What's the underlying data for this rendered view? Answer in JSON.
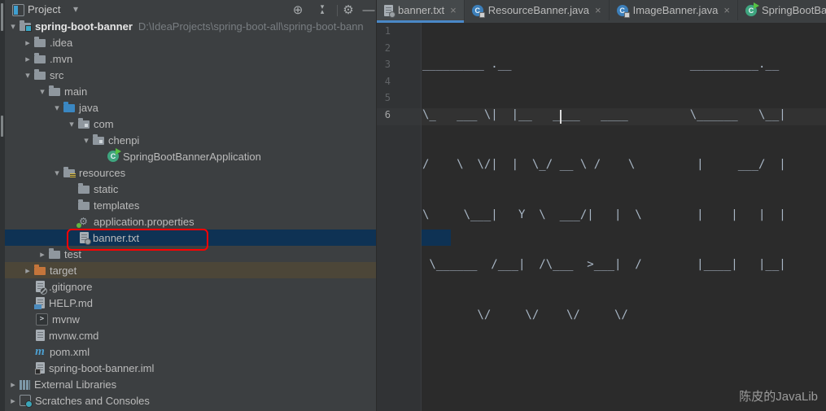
{
  "header": {
    "title": "Project"
  },
  "icons": {
    "dropdown": "▾",
    "close": "×",
    "gear": "⚙",
    "minimize": "—",
    "locate": "⊕",
    "collapse_top": "▾",
    "collapse_bottom": "▴",
    "class_letter": "C",
    "maven_letter": "m",
    "terminal_prompt": ">"
  },
  "tree": [
    {
      "label": "spring-boot-banner",
      "path": "D:\\IdeaProjects\\spring-boot-all\\spring-boot-bann",
      "arrow": "▾"
    },
    {
      "label": ".idea",
      "arrow": "▸"
    },
    {
      "label": ".mvn",
      "arrow": "▸"
    },
    {
      "label": "src",
      "arrow": "▾"
    },
    {
      "label": "main",
      "arrow": "▾"
    },
    {
      "label": "java",
      "arrow": "▾"
    },
    {
      "label": "com",
      "arrow": "▾"
    },
    {
      "label": "chenpi",
      "arrow": "▾"
    },
    {
      "label": "SpringBootBannerApplication"
    },
    {
      "label": "resources",
      "arrow": "▾"
    },
    {
      "label": "static"
    },
    {
      "label": "templates"
    },
    {
      "label": "application.properties"
    },
    {
      "label": "banner.txt"
    },
    {
      "label": "test",
      "arrow": "▸"
    },
    {
      "label": "target",
      "arrow": "▸"
    },
    {
      "label": ".gitignore"
    },
    {
      "label": "HELP.md"
    },
    {
      "label": "mvnw"
    },
    {
      "label": "mvnw.cmd"
    },
    {
      "label": "pom.xml"
    },
    {
      "label": "spring-boot-banner.iml"
    },
    {
      "label": "External Libraries",
      "arrow": "▸"
    },
    {
      "label": "Scratches and Consoles",
      "arrow": "▸"
    }
  ],
  "editor": {
    "tabs": [
      {
        "label": "banner.txt"
      },
      {
        "label": "ResourceBanner.java"
      },
      {
        "label": "ImageBanner.java"
      },
      {
        "label": "SpringBootBann"
      }
    ],
    "gutter": [
      "1",
      "2",
      "3",
      "4",
      "5",
      "6"
    ],
    "lines": [
      "_________ .__                          __________.__",
      "\\_   ___ \\|  |__   ____   ____         \\______   \\__|",
      "/    \\  \\/|  |  \\_/ __ \\ /    \\         |     ___/  |",
      "\\     \\___|   Y  \\  ___/|   |  \\        |    |   |  |",
      " \\______  /___|  /\\___  >___|  /        |____|   |__|",
      "        \\/     \\/    \\/     \\/"
    ],
    "watermark": "陈皮的JavaLib"
  },
  "colors": {
    "panel_bg": "#3c3f41",
    "editor_bg": "#2b2b2b",
    "gutter_bg": "#313335",
    "selection_bg": "#0e3254",
    "excluded_bg": "#4c4638",
    "annotation_red": "#ff0000",
    "tab_underline": "#4a88c7",
    "art_text": "#a9b7c6"
  }
}
